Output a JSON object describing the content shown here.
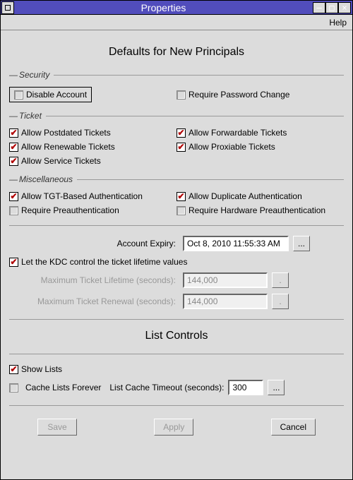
{
  "window": {
    "title": "Properties"
  },
  "menubar": {
    "help": "Help"
  },
  "main": {
    "heading": "Defaults for New Principals",
    "groups": {
      "security": {
        "label": "Security",
        "disable_account": "Disable Account",
        "require_pw_change": "Require Password Change"
      },
      "ticket": {
        "label": "Ticket",
        "allow_postdated": "Allow Postdated Tickets",
        "allow_forwardable": "Allow Forwardable Tickets",
        "allow_renewable": "Allow Renewable Tickets",
        "allow_proxiable": "Allow Proxiable Tickets",
        "allow_service": "Allow Service Tickets"
      },
      "misc": {
        "label": "Miscellaneous",
        "allow_tgt": "Allow TGT-Based Authentication",
        "allow_dup": "Allow Duplicate Authentication",
        "require_preauth": "Require Preauthentication",
        "require_hw_preauth": "Require Hardware Preauthentication"
      }
    },
    "expiry": {
      "label": "Account Expiry:",
      "value": "Oct 8, 2010 11:55:33 AM"
    },
    "kdc_control": {
      "label": "Let the KDC control the ticket lifetime values"
    },
    "max_lifetime": {
      "label": "Maximum Ticket Lifetime (seconds):",
      "value": "144,000"
    },
    "max_renewal": {
      "label": "Maximum Ticket Renewal (seconds):",
      "value": "144,000"
    },
    "list_controls": {
      "heading": "List Controls",
      "show_lists": "Show Lists",
      "cache_forever": "Cache Lists Forever",
      "cache_timeout_label": "List Cache Timeout (seconds):",
      "cache_timeout_value": "300"
    },
    "buttons": {
      "save": "Save",
      "apply": "Apply",
      "cancel": "Cancel"
    },
    "browse": "..."
  }
}
